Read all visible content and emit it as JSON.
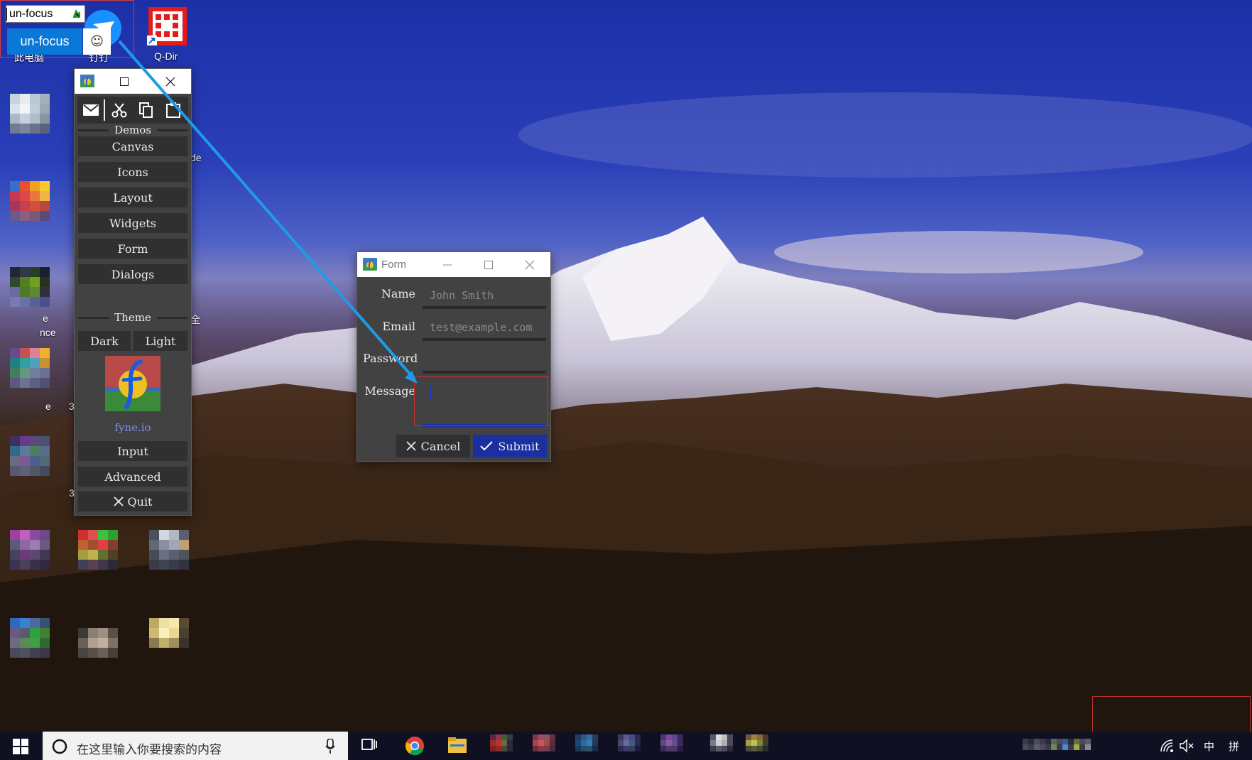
{
  "unfocus": {
    "input_value": "un-focus",
    "button_label": "un-focus",
    "smile_glyph": "☺"
  },
  "desktop": {
    "icons": [
      {
        "label": "此电脑",
        "icon": "computer-icon"
      },
      {
        "label": "钉钉",
        "icon": "dingtalk-icon"
      },
      {
        "label": "Q-Dir",
        "icon": "qdir-icon"
      }
    ],
    "partial_labels": [
      "de",
      "e",
      "nce",
      "全",
      "e",
      "3",
      "3"
    ]
  },
  "demo_window": {
    "toolbar": [
      "mail-icon",
      "cut-icon",
      "copy-icon",
      "paste-icon"
    ],
    "demos_label": "Demos",
    "items": [
      "Canvas",
      "Icons",
      "Layout",
      "Widgets",
      "Form",
      "Dialogs"
    ],
    "theme_label": "Theme",
    "theme_dark": "Dark",
    "theme_light": "Light",
    "brand": "fyne.io",
    "input": "Input",
    "advanced": "Advanced",
    "quit": "Quit"
  },
  "form_window": {
    "title": "Form",
    "name_label": "Name",
    "name_placeholder": "John Smith",
    "email_label": "Email",
    "email_placeholder": "test@example.com",
    "password_label": "Password",
    "message_label": "Message",
    "cancel": "Cancel",
    "submit": "Submit"
  },
  "taskbar": {
    "search_placeholder": "在这里输入你要搜索的内容",
    "ime_lang": "中",
    "ime_mode": "拼"
  },
  "colors": {
    "accent_blue": "#0a78d7",
    "submit_blue": "#1a2fa0",
    "focus_red": "#c83030",
    "annotation_arrow": "#1e9be8"
  }
}
